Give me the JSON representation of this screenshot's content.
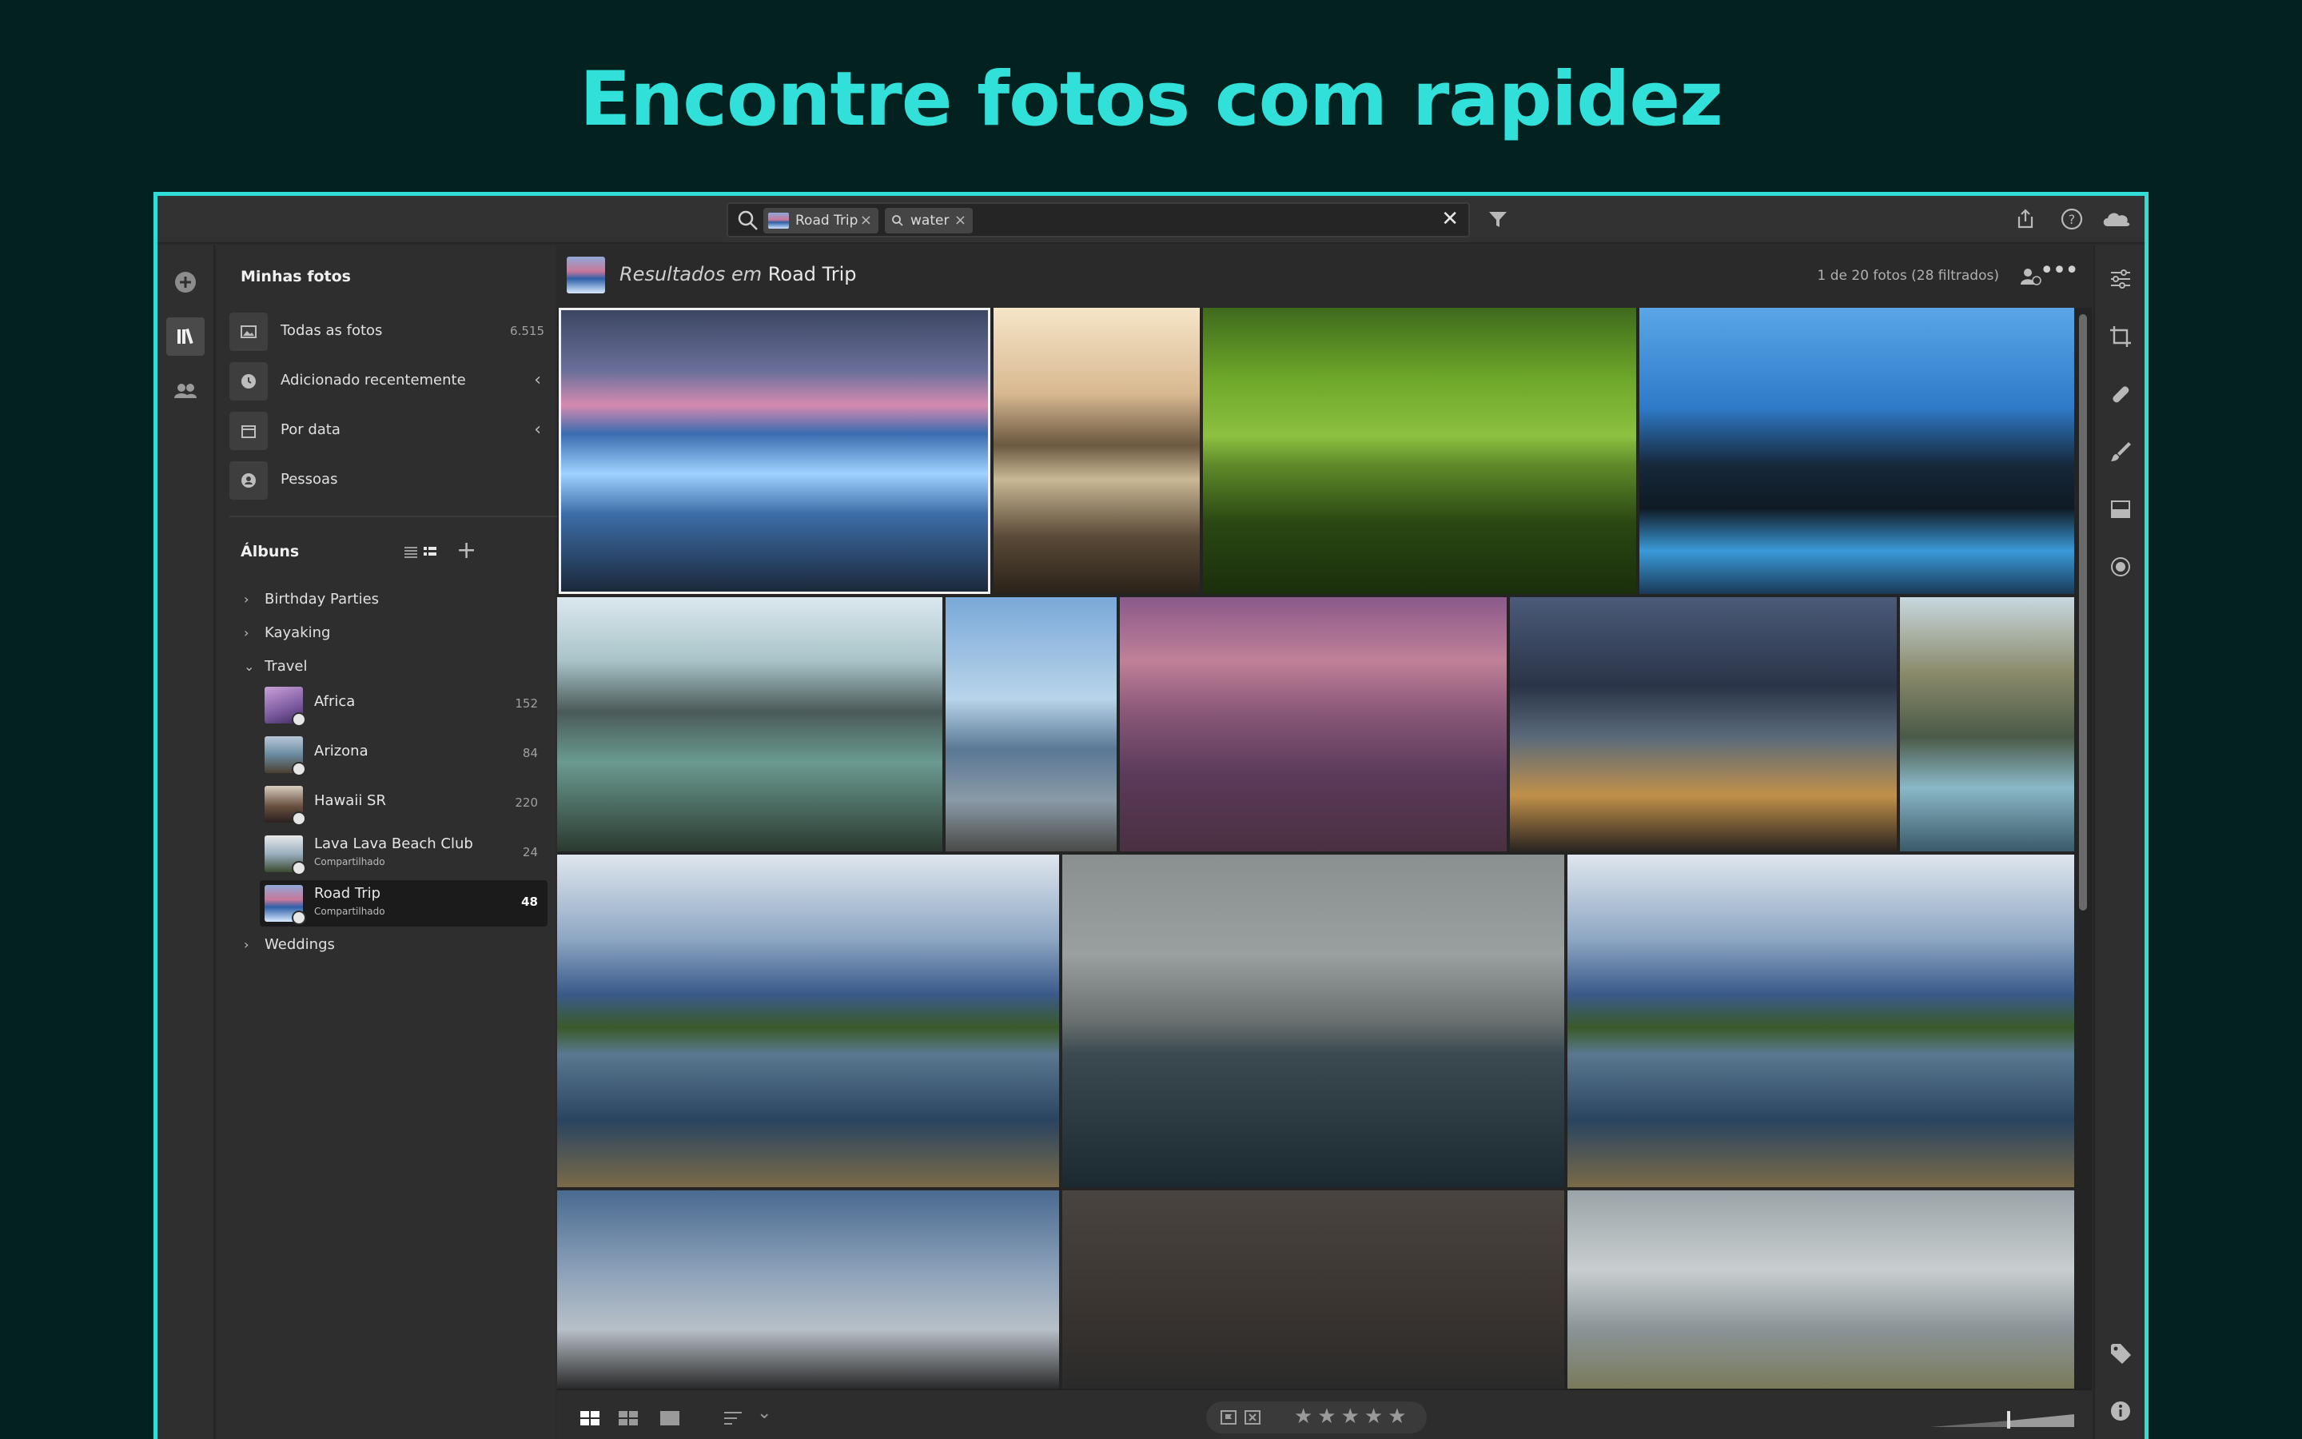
{
  "headline": "Encontre fotos com rapidez",
  "search": {
    "chips": [
      "Road Trip",
      "water"
    ]
  },
  "sidebar": {
    "my_photos_title": "Minhas fotos",
    "nav": [
      {
        "label": "Todas as fotos",
        "count": "6.515"
      },
      {
        "label": "Adicionado recentemente"
      },
      {
        "label": "Por data"
      },
      {
        "label": "Pessoas"
      }
    ],
    "albums_title": "Álbuns",
    "albums": [
      {
        "label": "Birthday Parties"
      },
      {
        "label": "Kayaking"
      },
      {
        "label": "Travel"
      },
      {
        "label": "Weddings"
      }
    ],
    "travel_albums": [
      {
        "label": "Africa",
        "count": "152"
      },
      {
        "label": "Arizona",
        "count": "84"
      },
      {
        "label": "Hawaii SR",
        "count": "220"
      },
      {
        "label": "Lava Lava Beach Club",
        "sub": "Compartilhado",
        "count": "24"
      },
      {
        "label": "Road Trip",
        "sub": "Compartilhado",
        "count": "48"
      }
    ]
  },
  "main": {
    "title_prefix": "Resultados em",
    "title_album": "Road Trip",
    "meta": "1 de 20 fotos  (28 filtrados)"
  },
  "icons": {
    "accent": "#31e0d8",
    "border": "#2fdcd6"
  }
}
